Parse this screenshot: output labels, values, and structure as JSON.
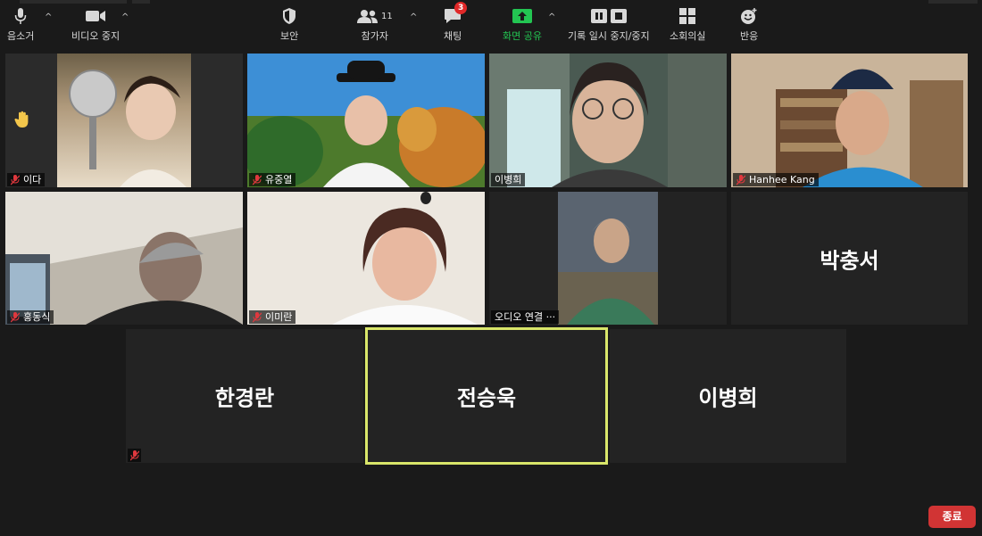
{
  "participants": {
    "p1": {
      "name": "이다",
      "hand_raised": true,
      "muted": true
    },
    "p2": {
      "name": "유중열",
      "muted": true
    },
    "p3": {
      "name": "이병희",
      "muted": false
    },
    "p4": {
      "name": "Hanhee Kang",
      "muted": true
    },
    "p5": {
      "name": "홍동식",
      "muted": true
    },
    "p6": {
      "name": "이미란",
      "muted": true
    },
    "p7": {
      "name": "오디오 연결 ···",
      "muted": false
    },
    "p8": {
      "name": "박충서"
    },
    "p9": {
      "name": "한경란",
      "muted": true
    },
    "p10": {
      "name": "전승욱",
      "active_speaker": true
    },
    "p11": {
      "name": "이병희"
    }
  },
  "toolbar": {
    "mute_label": "음소거",
    "video_label": "비디오 중지",
    "security_label": "보안",
    "participants_label": "참가자",
    "participants_count": "11",
    "chat_label": "채팅",
    "chat_badge": "3",
    "share_label": "화면 공유",
    "record_label": "기록 일시 중지/중지",
    "breakout_label": "소회의실",
    "reactions_label": "반응",
    "end_label": "종료"
  },
  "colors": {
    "active_speaker_border": "#d9e66a",
    "share_green": "#23c552",
    "end_red": "#d13434",
    "badge_red": "#e02828",
    "mute_red": "#e0383e"
  },
  "icons": [
    "mic-icon",
    "video-icon",
    "shield-icon",
    "participants-icon",
    "chat-icon",
    "share-screen-icon",
    "pause-icon",
    "stop-icon",
    "breakout-grid-icon",
    "reaction-smile-icon",
    "raised-hand-icon",
    "mic-muted-icon"
  ]
}
